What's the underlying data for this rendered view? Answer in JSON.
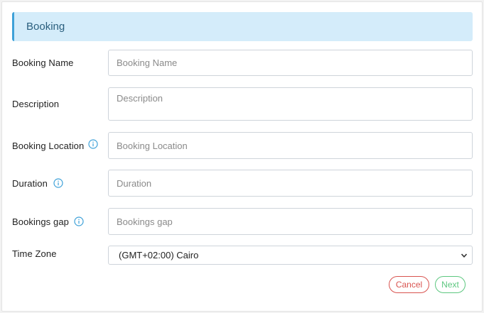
{
  "section": {
    "title": "Booking"
  },
  "form": {
    "booking_name": {
      "label": "Booking Name",
      "placeholder": "Booking Name",
      "value": ""
    },
    "description": {
      "label": "Description",
      "placeholder": "Description",
      "value": ""
    },
    "booking_location": {
      "label": "Booking Location",
      "placeholder": "Booking Location",
      "value": ""
    },
    "duration": {
      "label": "Duration",
      "placeholder": "Duration",
      "value": ""
    },
    "bookings_gap": {
      "label": "Bookings gap",
      "placeholder": "Bookings gap",
      "value": ""
    },
    "time_zone": {
      "label": "Time Zone",
      "selected": "(GMT+02:00) Cairo"
    }
  },
  "actions": {
    "cancel": "Cancel",
    "next": "Next"
  },
  "icons": {
    "info": "info-circle-icon",
    "dropdown": "chevron-down-icon"
  },
  "colors": {
    "accent": "#3ea1d8",
    "header_bg": "#d4ecfa",
    "cancel": "#d9534f",
    "next": "#5cc77f"
  }
}
